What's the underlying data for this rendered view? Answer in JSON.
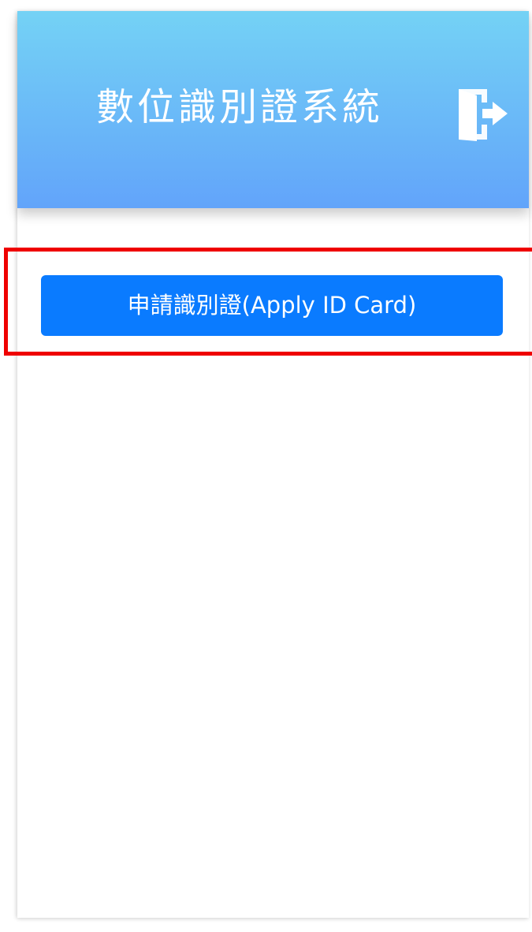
{
  "header": {
    "title": "數位識別證系統",
    "logout_icon": "sign-out-icon",
    "gradient_top": "#74d2f5",
    "gradient_bottom": "#62a4fa"
  },
  "main": {
    "apply_button_label": "申請識別證(Apply ID Card)",
    "apply_button_color": "#0a7bff"
  },
  "annotation": {
    "highlight_color": "#ef0000"
  }
}
